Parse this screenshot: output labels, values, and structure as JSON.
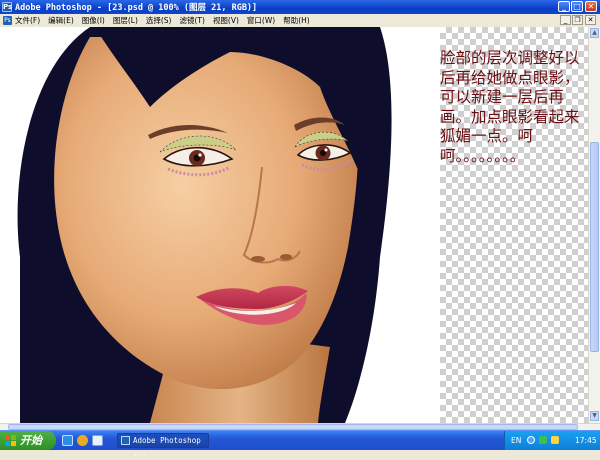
{
  "window": {
    "title": "Adobe Photoshop - [23.psd @ 100% (图层 21, RGB)]",
    "app_icon_glyph": "Ps",
    "minimize_glyph": "_",
    "maximize_glyph": "□",
    "close_glyph": "✕"
  },
  "menu": {
    "logo_glyph": "Ps",
    "items": [
      "文件(F)",
      "编辑(E)",
      "图像(I)",
      "图层(L)",
      "选择(S)",
      "滤镜(T)",
      "视图(V)",
      "窗口(W)",
      "帮助(H)"
    ],
    "doc_minimize_glyph": "_",
    "doc_restore_glyph": "❐",
    "doc_close_glyph": "✕"
  },
  "canvas": {
    "note_text": "脸部的层次调整好以后再给她做点眼影，可以新建一层后再画。加点眼影看起来狐媚一点。呵呵。。。。。。。。",
    "note_color": "#6b0f14"
  },
  "scrollbar": {
    "up_glyph": "▲",
    "down_glyph": "▼"
  },
  "taskbar": {
    "start_label": "开始",
    "task_label": "Adobe Photoshop ...",
    "lang": "EN",
    "time": "17:45"
  },
  "icons": {
    "app": "photoshop-icon",
    "quicklaunch": [
      "ie-icon",
      "media-player-icon",
      "show-desktop-icon"
    ],
    "tray": [
      "help-icon",
      "network-icon",
      "volume-icon"
    ]
  },
  "colors": {
    "titlebar": "#0a3fc4",
    "taskbar": "#2357d6",
    "start": "#2d8f23"
  }
}
